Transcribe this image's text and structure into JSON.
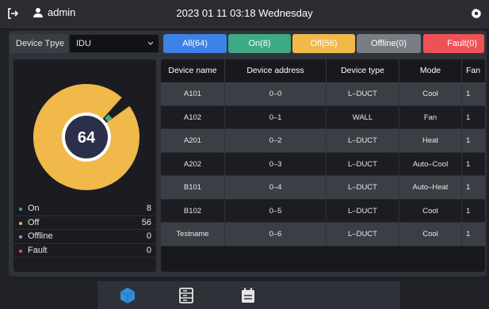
{
  "header": {
    "user": "admin",
    "datetime": "2023 01 11 03:18 Wednesday"
  },
  "filter": {
    "device_type_label": "Device Tpye",
    "device_type_value": "IDU",
    "buttons": {
      "all": "All(64)",
      "on": "On(8)",
      "off": "Off(56)",
      "offline": "Offline(0)",
      "fault": "Fault(0)"
    }
  },
  "stats": {
    "total": "64",
    "on_count": 8,
    "off_count": 56,
    "legend": [
      {
        "label": "On",
        "value": "8",
        "color": "#3daa84"
      },
      {
        "label": "Off",
        "value": "56",
        "color": "#f1b84a"
      },
      {
        "label": "Offline",
        "value": "0",
        "color": "#9a9da3"
      },
      {
        "label": "Fault",
        "value": "0",
        "color": "#ee5156"
      }
    ]
  },
  "table": {
    "columns": [
      "Device name",
      "Device address",
      "Device type",
      "Mode",
      "Fan"
    ],
    "rows": [
      [
        "A101",
        "0–0",
        "L–DUCT",
        "Cool",
        "1"
      ],
      [
        "A102",
        "0–1",
        "WALL",
        "Fan",
        "1"
      ],
      [
        "A201",
        "0–2",
        "L–DUCT",
        "Heat",
        "1"
      ],
      [
        "A202",
        "0–3",
        "L–DUCT",
        "Auto–Cool",
        "1"
      ],
      [
        "B101",
        "0–4",
        "L–DUCT",
        "Auto–Heat",
        "1"
      ],
      [
        "B102",
        "0–5",
        "L–DUCT",
        "Cool",
        "1"
      ],
      [
        "Testname",
        "0–6",
        "L–DUCT",
        "Cool",
        "1"
      ]
    ]
  },
  "icons": {
    "logout": "logout-icon",
    "user": "user-icon",
    "settings": "gear-icon",
    "nav": [
      "cube-icon",
      "list-icon",
      "calendar-icon"
    ]
  },
  "colors": {
    "accent_blue": "#3d82e6",
    "on_green": "#3daa84",
    "off_yellow": "#f1b84a",
    "offline_gray": "#797c82",
    "fault_red": "#ee5156",
    "nav_active": "#2f8fd9"
  }
}
